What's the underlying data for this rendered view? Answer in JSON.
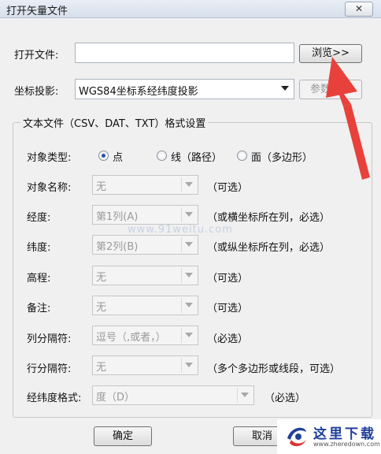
{
  "window": {
    "title": "打开矢量文件",
    "close_glyph": "✕"
  },
  "file": {
    "label": "打开文件:",
    "value": "",
    "browse_label": "浏览>>"
  },
  "projection": {
    "label": "坐标投影:",
    "value": "WGS84坐标系经纬度投影",
    "params_label": "参数设置"
  },
  "group": {
    "title": "文本文件（CSV、DAT、TXT）格式设置",
    "object_type": {
      "label": "对象类型:",
      "options": [
        {
          "label": "点",
          "checked": true
        },
        {
          "label": "线（路径）",
          "checked": false
        },
        {
          "label": "面（多边形）",
          "checked": false
        }
      ]
    },
    "rows": [
      {
        "label": "对象名称:",
        "value": "无",
        "hint": "（可选）"
      },
      {
        "label": "经度:",
        "value": "第1列(A)",
        "hint": "（或横坐标所在列，必选）"
      },
      {
        "label": "纬度:",
        "value": "第2列(B)",
        "hint": "（或纵坐标所在列，必选）"
      },
      {
        "label": "高程:",
        "value": "无",
        "hint": "（可选）"
      },
      {
        "label": "备注:",
        "value": "无",
        "hint": "（可选）"
      },
      {
        "label": "列分隔符:",
        "value": "逗号（,或者，）",
        "hint": "（必选）"
      },
      {
        "label": "行分隔符:",
        "value": "无",
        "hint": "（多个多边形或线段，可选）"
      },
      {
        "label": "经纬度格式:",
        "value": "度（D）",
        "hint": "（必选）"
      }
    ]
  },
  "buttons": {
    "ok": "确定",
    "cancel": "取消"
  },
  "watermark": "www.91weitu.com",
  "logo": {
    "text": "这里下载",
    "url": "www.zheredown.com"
  },
  "colors": {
    "arrow": "#e8413b",
    "logo_blue": "#1f3f9a"
  }
}
